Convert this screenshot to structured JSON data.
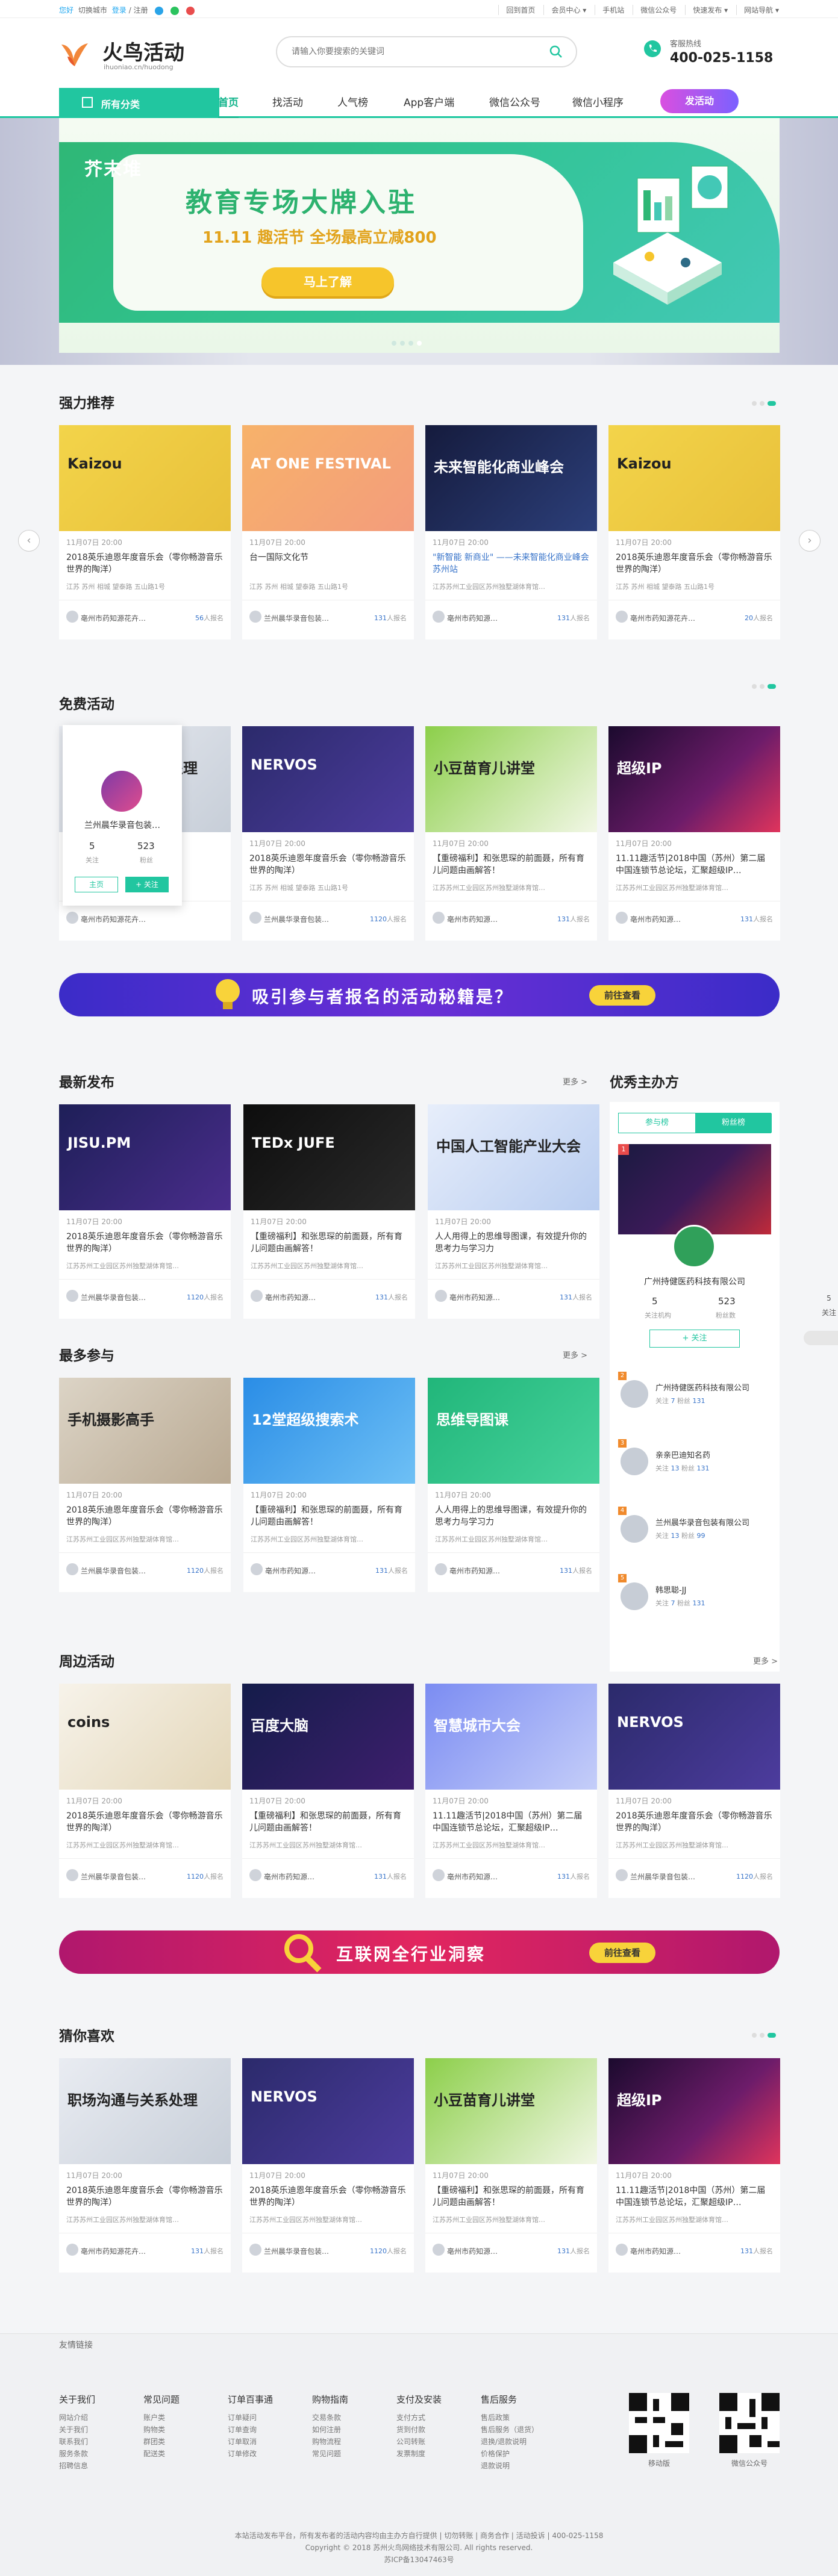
{
  "topbar": {
    "welcome": "您好",
    "city": "切换城市",
    "login": "登录",
    "register": "注册",
    "links": [
      "回到首页",
      "会员中心 ▾",
      "手机站",
      "微信公众号",
      "快速发布 ▾",
      "网站导航 ▾"
    ]
  },
  "header": {
    "logo_text": "火鸟活动",
    "logo_sub": "ihuoniao.cn/huodong",
    "search_placeholder": "请输入你要搜索的关键词",
    "hotline_label": "客服热线",
    "hotline_number": "400-025-1158"
  },
  "nav": {
    "all_categories": "所有分类",
    "items": [
      "首页",
      "找活动",
      "人气榜",
      "App客户端",
      "微信公众号",
      "微信小程序"
    ],
    "publish": "发活动"
  },
  "banner": {
    "brand": "芥末堆",
    "headline": "教育专场大牌入驻",
    "subline": "11.11 趣活节 全场最高立减800",
    "cta": "马上了解"
  },
  "sections": {
    "recommend": "强力推荐",
    "free": "免费活动",
    "latest": "最新发布",
    "popular": "最多参与",
    "nearby": "周边活动",
    "guess": "猜你喜欢",
    "top_host": "优秀主办方",
    "more": "更多 >"
  },
  "card_common": {
    "date": "11月07日  20:00",
    "loc": "江苏苏州工业园区苏州独墅湖体育馆…"
  },
  "recommend_cards": [
    {
      "title": "2018英乐迪恩年度音乐会（零你畅游音乐世界的陶洋）",
      "loc": "江苏 苏州 相城 望泰路 五山路1号",
      "org": "亳州市药知源花卉…",
      "count": "56",
      "img": "Kaizou",
      "blue": false
    },
    {
      "title": "台一国际文化节",
      "loc": "江苏 苏州 相城 望泰路 五山路1号",
      "org": "兰州晨华录音包装…",
      "count": "131",
      "img": "AT ONE FESTIVAL",
      "blue": false
    },
    {
      "title": "\"新智能 新商业\" ——未来智能化商业峰会 苏州站",
      "loc": "江苏苏州工业园区苏州独墅湖体育馆…",
      "org": "亳州市药知源…",
      "count": "131",
      "img": "未来智能化商业峰会",
      "blue": true
    },
    {
      "title": "2018英乐迪恩年度音乐会（零你畅游音乐世界的陶洋）",
      "loc": "江苏 苏州 相城 望泰路 五山路1号",
      "org": "亳州市药知源花卉…",
      "count": "20",
      "img": "Kaizou",
      "blue": false
    }
  ],
  "free_cards": [
    {
      "title": "职场沟通与关系处理",
      "loc": "江苏 苏州",
      "org": "亳州市药知源花卉…",
      "count": "",
      "img": "职场沟通与关系处理"
    },
    {
      "title": "2018英乐迪恩年度音乐会（零你畅游音乐世界的陶洋）",
      "loc": "江苏 苏州 相城 望泰路 五山路1号",
      "org": "兰州晨华录音包装…",
      "count": "1120",
      "img": "NERVOS"
    },
    {
      "title": "【重磅福利】和张思琛的前面聂，所有育儿问题由画解答！",
      "loc": "江苏苏州工业园区苏州独墅湖体育馆…",
      "org": "亳州市药知源…",
      "count": "131",
      "img": "小豆苗育儿讲堂"
    },
    {
      "title": "11.11趣活节|2018中国（苏州）第二届中国连锁节总论坛，汇聚超级IP…",
      "loc": "江苏苏州工业园区苏州独墅湖体育馆…",
      "org": "亳州市药知源…",
      "count": "131",
      "img": "超级IP"
    }
  ],
  "popup": {
    "org_name": "兰州晨华录音包装…",
    "follows": "5",
    "follow_label": "关注",
    "fans": "523",
    "fans_label": "粉丝",
    "home_btn": "主页",
    "follow_btn": "+ 关注"
  },
  "ad1": {
    "text": "吸引参与者报名的活动秘籍是？",
    "btn": "前往查看"
  },
  "latest_cards": [
    {
      "title": "2018英乐迪恩年度音乐会（零你畅游音乐世界的陶洋）",
      "org": "兰州晨华录音包装…",
      "count": "1120",
      "img": "JISU.PM"
    },
    {
      "title": "【重磅福利】和张思琛的前面聂，所有育儿问题由画解答！",
      "org": "亳州市药知源…",
      "count": "131",
      "img": "TEDx JUFE"
    },
    {
      "title": "人人用得上的思维导图课，有效提升你的思考力与学习力",
      "org": "亳州市药知源…",
      "count": "131",
      "img": "中国人工智能产业大会"
    }
  ],
  "popular_cards": [
    {
      "title": "2018英乐迪恩年度音乐会（零你畅游音乐世界的陶洋）",
      "org": "兰州晨华录音包装…",
      "count": "1120",
      "img": "手机摄影高手"
    },
    {
      "title": "【重磅福利】和张思琛的前面聂，所有育儿问题由画解答！",
      "org": "亳州市药知源…",
      "count": "131",
      "img": "12堂超级搜索术"
    },
    {
      "title": "人人用得上的思维导图课，有效提升你的思考力与学习力",
      "org": "亳州市药知源…",
      "count": "131",
      "img": "思维导图课"
    }
  ],
  "hosts": {
    "tab_follow": "参与榜",
    "tab_fans": "粉丝榜",
    "top_name": "广州持健医药科技有限公司",
    "top_follow": "5",
    "top_fans": "523",
    "follow_label": "关注机构",
    "fans_label": "粉丝数",
    "follow_btn": "+ 关注",
    "list": [
      {
        "no": "2",
        "name": "广州持健医药科技有限公司",
        "follow": "7",
        "fans": "131"
      },
      {
        "no": "3",
        "name": "亲亲巴迪知名药",
        "follow": "13",
        "fans": "131"
      },
      {
        "no": "4",
        "name": "兰州晨华录音包装有限公司",
        "follow": "13",
        "fans": "99"
      },
      {
        "no": "5",
        "name": "韩思聪-JJ",
        "follow": "7",
        "fans": "131"
      }
    ]
  },
  "nearby_cards": [
    {
      "title": "2018英乐迪恩年度音乐会（零你畅游音乐世界的陶洋）",
      "org": "兰州晨华录音包装…",
      "count": "1120",
      "img": "coins"
    },
    {
      "title": "【重磅福利】和张思琛的前面聂，所有育儿问题由画解答！",
      "org": "亳州市药知源…",
      "count": "131",
      "img": "百度大脑"
    },
    {
      "title": "11.11趣活节|2018中国（苏州）第二届中国连锁节总论坛，汇聚超级IP…",
      "org": "亳州市药知源…",
      "count": "131",
      "img": "智慧城市大会"
    },
    {
      "title": "2018英乐迪恩年度音乐会（零你畅游音乐世界的陶洋）",
      "org": "兰州晨华录音包装…",
      "count": "1120",
      "img": "NERVOS"
    }
  ],
  "ad2": {
    "text": "互联网全行业洞察",
    "btn": "前往查看"
  },
  "guess_cards": [
    {
      "title": "2018英乐迪恩年度音乐会（零你畅游音乐世界的陶洋）",
      "org": "亳州市药知源花卉…",
      "count": "131",
      "img": "职场沟通与关系处理"
    },
    {
      "title": "2018英乐迪恩年度音乐会（零你畅游音乐世界的陶洋）",
      "org": "兰州晨华录音包装…",
      "count": "1120",
      "img": "NERVOS"
    },
    {
      "title": "【重磅福利】和张思琛的前面聂，所有育儿问题由画解答！",
      "org": "亳州市药知源…",
      "count": "131",
      "img": "小豆苗育儿讲堂"
    },
    {
      "title": "11.11趣活节|2018中国（苏州）第二届中国连锁节总论坛，汇聚超级IP…",
      "org": "亳州市药知源…",
      "count": "131",
      "img": "超级IP"
    }
  ],
  "side_flags": [
    "5",
    "关注"
  ],
  "footer": {
    "friend_links": "友情链接",
    "cols": [
      {
        "title": "关于我们",
        "items": [
          "网站介绍",
          "关于我们",
          "联系我们",
          "服务条款",
          "招聘信息"
        ]
      },
      {
        "title": "常见问题",
        "items": [
          "账户类",
          "购物类",
          "群团类",
          "配送类"
        ]
      },
      {
        "title": "订单百事通",
        "items": [
          "订单疑问",
          "订单查询",
          "订单取消",
          "订单修改"
        ]
      },
      {
        "title": "购物指南",
        "items": [
          "交易条款",
          "如何注册",
          "购物流程",
          "常见问题"
        ]
      },
      {
        "title": "支付及安装",
        "items": [
          "支付方式",
          "货到付款",
          "公司转账",
          "发票制度"
        ]
      },
      {
        "title": "售后服务",
        "items": [
          "售后政策",
          "售后服务（退货）",
          "退换/退款说明",
          "价格保护",
          "退款说明"
        ]
      }
    ],
    "qr1": "移动版",
    "qr2": "微信公众号",
    "copy1": "本站活动发布平台，所有发布者的活动内容均由主办方自行提供 | 切勿转账 | 商务合作 | 活动投诉 | 400-025-1158",
    "copy2": "Copyright © 2018 苏州火鸟网络技术有限公司. All rights reserved.",
    "copy3": "苏ICP备13047463号"
  }
}
